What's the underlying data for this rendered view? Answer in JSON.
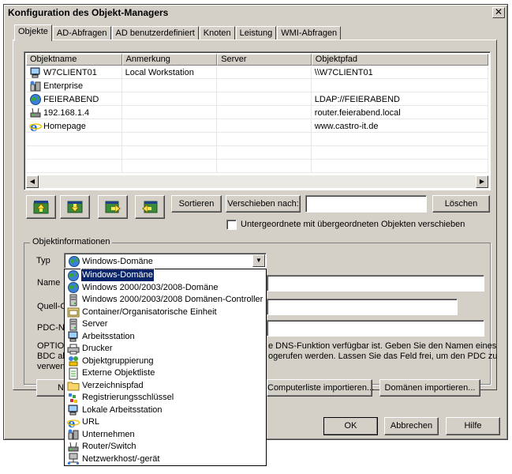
{
  "window": {
    "title": "Konfiguration des Objekt-Managers",
    "close_glyph": "✕"
  },
  "tabs": [
    {
      "label": "Objekte",
      "active": true
    },
    {
      "label": "AD-Abfragen"
    },
    {
      "label": "AD benutzerdefiniert"
    },
    {
      "label": "Knoten"
    },
    {
      "label": "Leistung"
    },
    {
      "label": "WMI-Abfragen"
    }
  ],
  "objects_list": {
    "columns": [
      "Objektname",
      "Anmerkung",
      "Server",
      "Objektpfad"
    ],
    "rows": [
      {
        "icon": "workstation-icon",
        "name": "W7CLIENT01",
        "note": "Local Workstation",
        "server": "",
        "path": "\\\\W7CLIENT01"
      },
      {
        "icon": "enterprise-icon",
        "name": "Enterprise",
        "note": "",
        "server": "",
        "path": ""
      },
      {
        "icon": "globe-icon",
        "name": "FEIERABEND",
        "note": "",
        "server": "",
        "path": "LDAP://FEIERABEND"
      },
      {
        "icon": "router-icon",
        "name": "192.168.1.4",
        "note": "",
        "server": "",
        "path": "router.feierabend.local"
      },
      {
        "icon": "ie-icon",
        "name": "Homepage",
        "note": "",
        "server": "",
        "path": "www.castro-it.de"
      }
    ]
  },
  "toolbar": {
    "sort_label": "Sortieren",
    "move_label": "Verschieben nach:",
    "move_value": "",
    "delete_label": "Löschen",
    "move_children_label": "Untergeordnete mit übergeordneten Objekten verschieben",
    "move_children_checked": false
  },
  "objinfo": {
    "group_title": "Objektinformationen",
    "type_label": "Typ",
    "type_value": "Windows-Domäne",
    "name_label": "Name",
    "source_label": "Quell-Co",
    "pdc_label": "PDC-Na",
    "desc_line1_left": "OPTION",
    "desc_line1_right": "e DNS-Funktion verfügbar ist. Geben Sie den Namen eines",
    "desc_line2_left": "BDC als",
    "desc_line2_right": "ogerufen werden. Lassen Sie das Feld frei, um den PDC zu",
    "desc_line3_left": "verwen",
    "new_button_partial": "N",
    "import_computers_label": "Computerliste importieren...",
    "import_domains_label": "Domänen importieren..."
  },
  "type_options": [
    {
      "icon": "globe-icon",
      "label": "Windows-Domäne",
      "selected": true
    },
    {
      "icon": "globe-icon",
      "label": "Windows 2000/2003/2008-Domäne"
    },
    {
      "icon": "server-icon",
      "label": "Windows 2000/2003/2008 Domänen-Controller"
    },
    {
      "icon": "container-icon",
      "label": "Container/Organisatorische Einheit"
    },
    {
      "icon": "server-icon",
      "label": "Server"
    },
    {
      "icon": "workstation-icon",
      "label": "Arbeitsstation"
    },
    {
      "icon": "printer-icon",
      "label": "Drucker"
    },
    {
      "icon": "group-icon",
      "label": "Objektgruppierung"
    },
    {
      "icon": "list-icon",
      "label": "Externe Objektliste"
    },
    {
      "icon": "folder-icon",
      "label": "Verzeichnispfad"
    },
    {
      "icon": "registry-icon",
      "label": "Registrierungsschlüssel"
    },
    {
      "icon": "workstation-icon",
      "label": "Lokale Arbeitsstation"
    },
    {
      "icon": "ie-icon",
      "label": "URL"
    },
    {
      "icon": "enterprise-icon",
      "label": "Unternehmen"
    },
    {
      "icon": "router-icon",
      "label": "Router/Switch"
    },
    {
      "icon": "network-host-icon",
      "label": "Netzwerkhost/-gerät"
    }
  ],
  "footer": {
    "ok_label": "OK",
    "cancel_label": "Abbrechen",
    "help_label": "Hilfe"
  }
}
